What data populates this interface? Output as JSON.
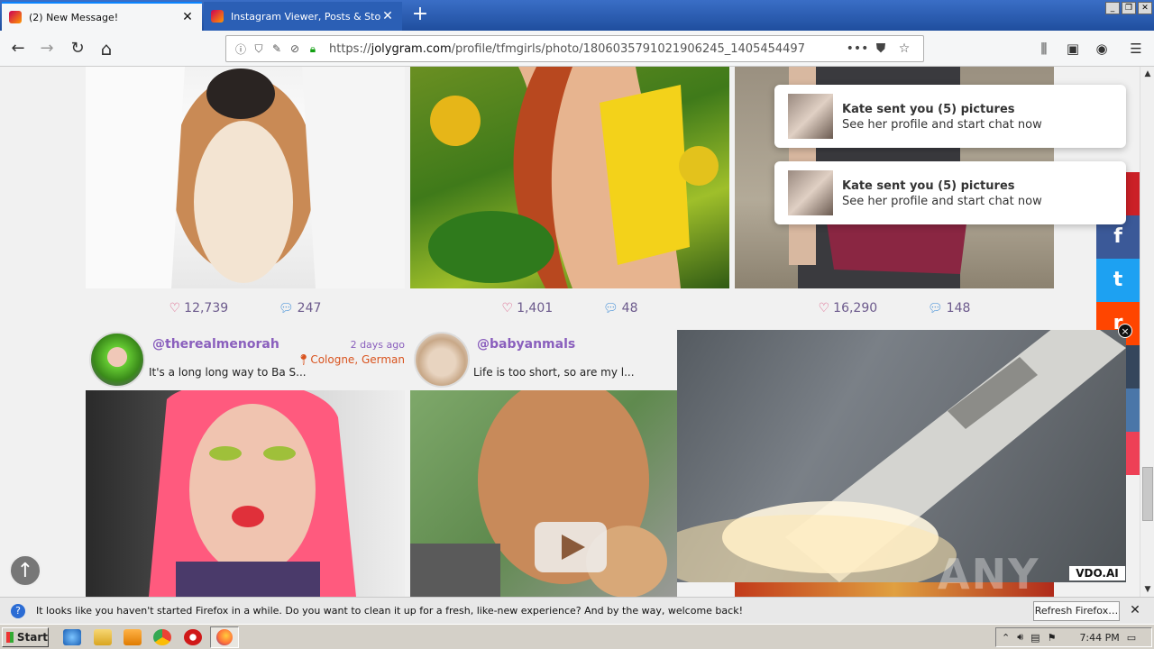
{
  "tabs": [
    {
      "title": "(2) New Message!",
      "active": true
    },
    {
      "title": "Instagram Viewer, Posts & Story Download",
      "active": false
    }
  ],
  "window_controls": [
    "_",
    "❐",
    "✕"
  ],
  "nav": {
    "back": "←",
    "forward": "→",
    "reload": "↻",
    "home": "⌂",
    "url_prefix": "https://",
    "url_domain": "jolygram.com",
    "url_path": "/profile/tfmgirls/photo/1806035791021906245_1405454497",
    "menu_dots": "•••"
  },
  "posts_top": [
    {
      "likes": "12,739",
      "comments": "247"
    },
    {
      "likes": "1,401",
      "comments": "48"
    },
    {
      "likes": "16,290",
      "comments": "148"
    }
  ],
  "posts_mid": [
    {
      "username": "@therealmenorah",
      "caption": "It's a long long way to Ba S...",
      "time": "2 days ago",
      "location": "Cologne, German"
    },
    {
      "username": "@babyanmals",
      "caption": "Life is too short, so are my l..."
    }
  ],
  "notifications": [
    {
      "title": "Kate sent you (5) pictures",
      "subtitle": "See her profile and start chat now"
    },
    {
      "title": "Kate sent you (5) pictures",
      "subtitle": "See her profile and start chat now"
    }
  ],
  "share": {
    "pinterest": "P",
    "facebook": "f",
    "twitter": "t",
    "reddit": "r"
  },
  "video": {
    "close": "×",
    "logo": "VDO.AI",
    "watermark": "ANY RUN"
  },
  "infobar": {
    "text": "It looks like you haven't started Firefox in a while. Do you want to clean it up for a fresh, like-new experience? And by the way, welcome back!",
    "button": "Refresh Firefox…",
    "close": "✕"
  },
  "taskbar": {
    "start": "Start",
    "clock": "7:44 PM"
  },
  "colors": {
    "accent": "#8a5fbd",
    "like": "#d94f7c",
    "comment": "#3a8ad6",
    "location": "#d9531e"
  }
}
